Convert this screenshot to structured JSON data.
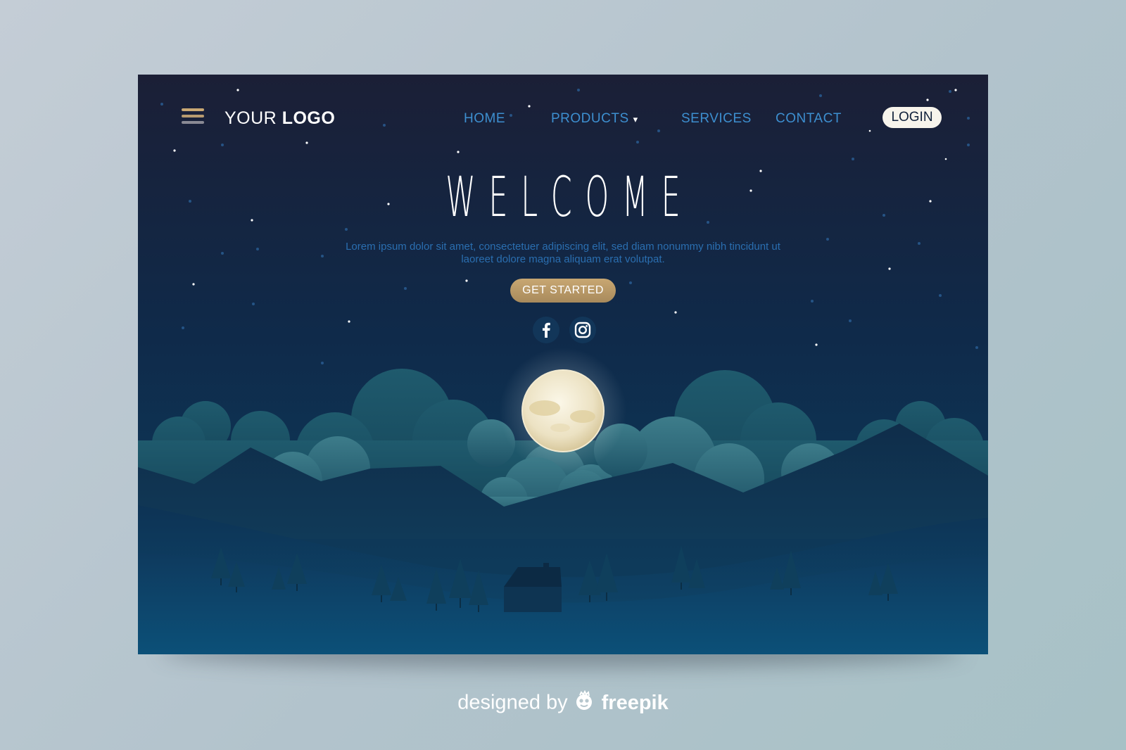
{
  "nav": {
    "logo_prefix": "YOUR ",
    "logo_bold": "LOGO",
    "links": [
      "HOME",
      "PRODUCTS",
      "SERVICES",
      "CONTACT"
    ],
    "products_caret": "▾",
    "login_label": "LOGIN",
    "menu_icon": "hamburger-icon"
  },
  "hero": {
    "title": "WELCOME",
    "lead": "Lorem ipsum dolor sit amet, consectetuer adipiscing elit, sed diam nonummy nibh tincidunt ut laoreet dolore magna aliquam erat volutpat.",
    "cta_label": "GET STARTED",
    "social": [
      "facebook-icon",
      "instagram-icon"
    ]
  },
  "credit": {
    "prefix": "designed by",
    "brand": "freepik"
  },
  "colors": {
    "accent_gold": "#c8a772",
    "nav_link": "#3d8fd0",
    "sky_top": "#1b1f36",
    "sky_bottom": "#0d4060"
  }
}
